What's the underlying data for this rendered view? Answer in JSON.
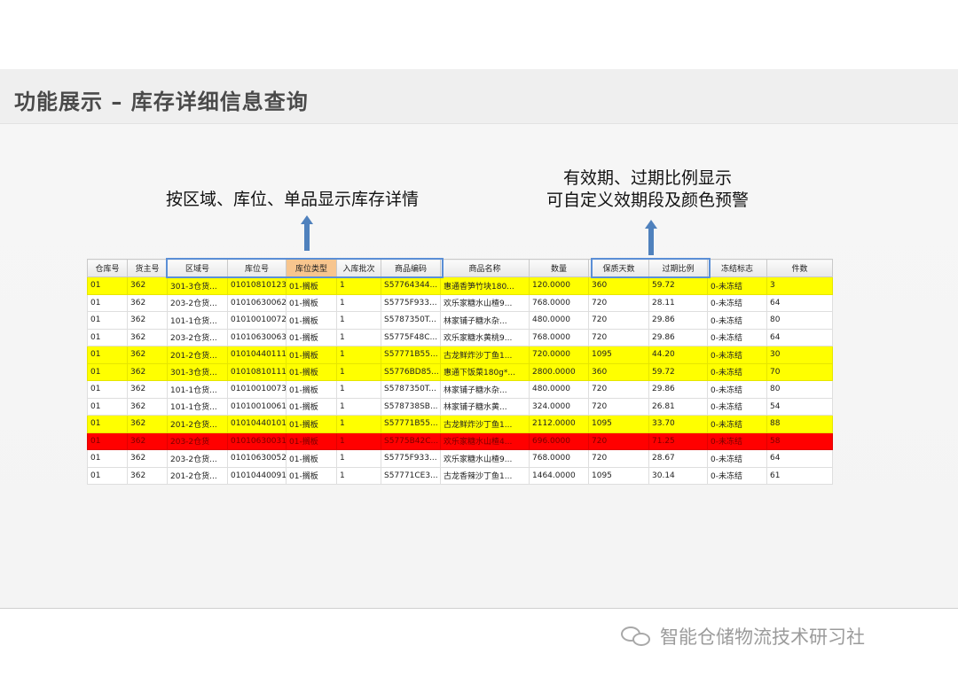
{
  "slide": {
    "title": "功能展示 – 库存详细信息查询",
    "caption_left": "按区域、库位、单品显示库存详情",
    "caption_right_line1": "有效期、过期比例显示",
    "caption_right_line2": "可自定义效期段及颜色预警"
  },
  "table": {
    "headers": [
      "仓库号",
      "货主号",
      "区域号",
      "库位号",
      "库位类型",
      "入库批次",
      "商品编码",
      "商品名称",
      "数量",
      "保质天数",
      "过期比例",
      "冻结标志",
      "件数"
    ],
    "rows": [
      {
        "color": "yellow",
        "cells": [
          "01",
          "362",
          "301-3仓货...",
          "01010810123",
          "01-搁板",
          "1",
          "S57764344...",
          "惠通香笋竹块180...",
          "120.0000",
          "360",
          "59.72",
          "0-未冻结",
          "3"
        ]
      },
      {
        "color": "white",
        "cells": [
          "01",
          "362",
          "203-2仓货...",
          "01010630062",
          "01-搁板",
          "1",
          "S5775F933...",
          "欢乐家糖水山楂9...",
          "768.0000",
          "720",
          "28.11",
          "0-未冻结",
          "64"
        ]
      },
      {
        "color": "white",
        "cells": [
          "01",
          "362",
          "101-1仓货...",
          "01010010072",
          "01-搁板",
          "1",
          "S5787350T...",
          "林家铺子糖水杂...",
          "480.0000",
          "720",
          "29.86",
          "0-未冻结",
          "80"
        ]
      },
      {
        "color": "white",
        "cells": [
          "01",
          "362",
          "203-2仓货...",
          "01010630063",
          "01-搁板",
          "1",
          "S5775F48C...",
          "欢乐家糖水黄桃9...",
          "768.0000",
          "720",
          "29.86",
          "0-未冻结",
          "64"
        ]
      },
      {
        "color": "yellow",
        "cells": [
          "01",
          "362",
          "201-2仓货...",
          "01010440111",
          "01-搁板",
          "1",
          "S57771B55...",
          "古龙鲜炸沙丁鱼1...",
          "720.0000",
          "1095",
          "44.20",
          "0-未冻结",
          "30"
        ]
      },
      {
        "color": "yellow",
        "cells": [
          "01",
          "362",
          "301-3仓货...",
          "01010810111",
          "01-搁板",
          "1",
          "S5776BD85...",
          "惠通下饭菜180g*...",
          "2800.0000",
          "360",
          "59.72",
          "0-未冻结",
          "70"
        ]
      },
      {
        "color": "white",
        "cells": [
          "01",
          "362",
          "101-1仓货...",
          "01010010073",
          "01-搁板",
          "1",
          "S5787350T...",
          "林家铺子糖水杂...",
          "480.0000",
          "720",
          "29.86",
          "0-未冻结",
          "80"
        ]
      },
      {
        "color": "white",
        "cells": [
          "01",
          "362",
          "101-1仓货...",
          "01010010061",
          "01-搁板",
          "1",
          "S578738SB...",
          "林家铺子糖水黄...",
          "324.0000",
          "720",
          "26.81",
          "0-未冻结",
          "54"
        ]
      },
      {
        "color": "yellow",
        "cells": [
          "01",
          "362",
          "201-2仓货...",
          "01010440101",
          "01-搁板",
          "1",
          "S57771B55...",
          "古龙鲜炸沙丁鱼1...",
          "2112.0000",
          "1095",
          "33.70",
          "0-未冻结",
          "88"
        ]
      },
      {
        "color": "red",
        "cells": [
          "01",
          "362",
          "203-2仓货",
          "01010630031",
          "01-搁板",
          "1",
          "S5775B42C...",
          "欢乐家糖水山楂4...",
          "696.0000",
          "720",
          "71.25",
          "0-未冻结",
          "58"
        ]
      },
      {
        "color": "white",
        "cells": [
          "01",
          "362",
          "203-2仓货...",
          "01010630052",
          "01-搁板",
          "1",
          "S5775F933...",
          "欢乐家糖水山楂9...",
          "768.0000",
          "720",
          "28.67",
          "0-未冻结",
          "64"
        ]
      },
      {
        "color": "white",
        "cells": [
          "01",
          "362",
          "201-2仓货...",
          "01010440091",
          "01-搁板",
          "1",
          "S57771CE3...",
          "古龙香辣沙丁鱼1...",
          "1464.0000",
          "1095",
          "30.14",
          "0-未冻结",
          "61"
        ]
      }
    ]
  },
  "footer": {
    "account_name": "智能仓储物流技术研习社"
  },
  "icons": {
    "arrow": "up-arrow-icon",
    "footer_logo": "wechat-icon"
  },
  "colors": {
    "row_warning": "#ffff00",
    "row_expired": "#ff0000",
    "highlight_box": "#5b8fd6",
    "arrow": "#4f81bd"
  }
}
